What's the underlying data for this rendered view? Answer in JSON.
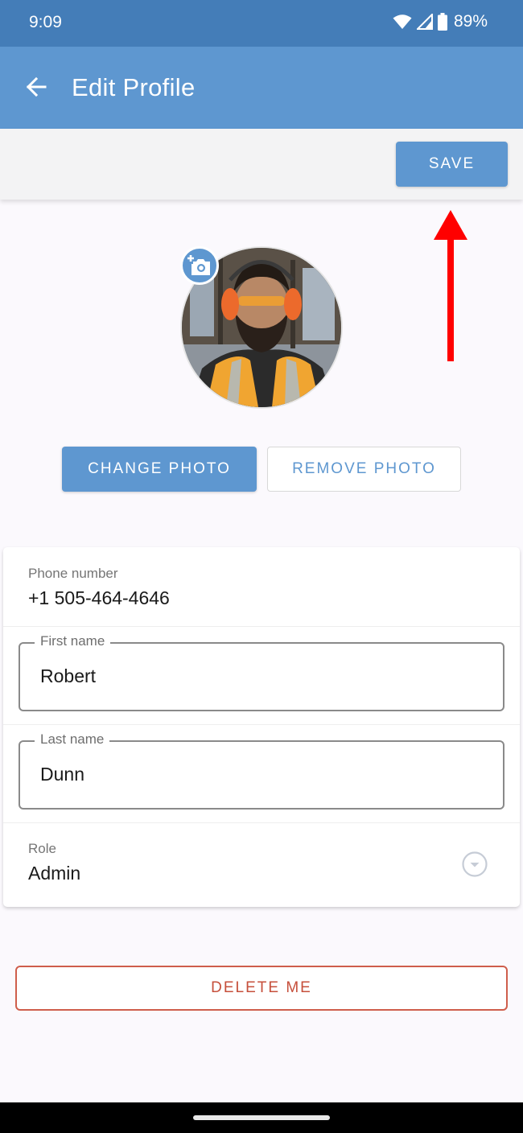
{
  "status_bar": {
    "time": "9:09",
    "battery_percent": "89%",
    "icons": [
      "wifi-icon",
      "cellular-signal-icon",
      "battery-icon"
    ]
  },
  "app_bar": {
    "title": "Edit Profile",
    "back_icon": "arrow-left-icon"
  },
  "toolbar": {
    "save_label": "SAVE"
  },
  "annotation": {
    "type": "arrow-up",
    "color": "#ff0000",
    "points_to": "save-button"
  },
  "profile_photo": {
    "alt": "Profile photo of a bearded worker with orange ear protection and safety vest",
    "badge_icon": "add-photo-camera-icon"
  },
  "photo_actions": {
    "change_label": "CHANGE PHOTO",
    "remove_label": "REMOVE PHOTO"
  },
  "form": {
    "phone": {
      "label": "Phone number",
      "value": "+1 505-464-4646"
    },
    "first_name": {
      "label": "First name",
      "value": "Robert"
    },
    "last_name": {
      "label": "Last name",
      "value": "Dunn"
    },
    "role": {
      "label": "Role",
      "value": "Admin",
      "icon": "dropdown-circle-icon"
    }
  },
  "danger": {
    "delete_label": "DELETE ME"
  },
  "colors": {
    "status_bar": "#447db8",
    "primary": "#5e97d0",
    "danger": "#c64f3b",
    "background": "#fbf9fd"
  }
}
